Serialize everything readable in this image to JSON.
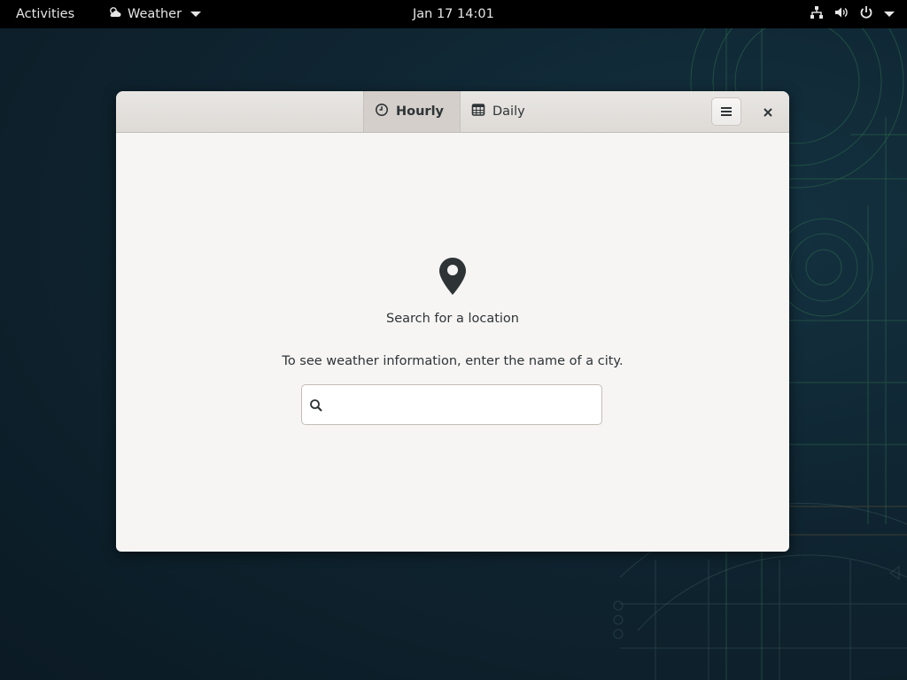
{
  "topbar": {
    "activities_label": "Activities",
    "app_name": "Weather",
    "app_icon": "weather-icon",
    "clock": "Jan 17  14:01",
    "status_icons": [
      "network-icon",
      "volume-icon",
      "power-icon"
    ]
  },
  "window": {
    "tabs": [
      {
        "label": "Hourly",
        "icon": "clock-icon",
        "active": true
      },
      {
        "label": "Daily",
        "icon": "calendar-icon",
        "active": false
      }
    ],
    "menu_icon": "hamburger-menu-icon",
    "close_icon": "close-icon",
    "empty_state": {
      "icon": "location-pin-icon",
      "title": "Search for a location",
      "subtitle": "To see weather information, enter the name of a city."
    },
    "search": {
      "value": "",
      "placeholder": ""
    }
  },
  "colors": {
    "window_bg": "#f6f5f4",
    "headerbar_bg": "#dedad6",
    "active_tab_bg": "#d4cfca",
    "text": "#2e3436",
    "topbar_bg": "#000000",
    "desktop_bg": "#0f2531"
  }
}
